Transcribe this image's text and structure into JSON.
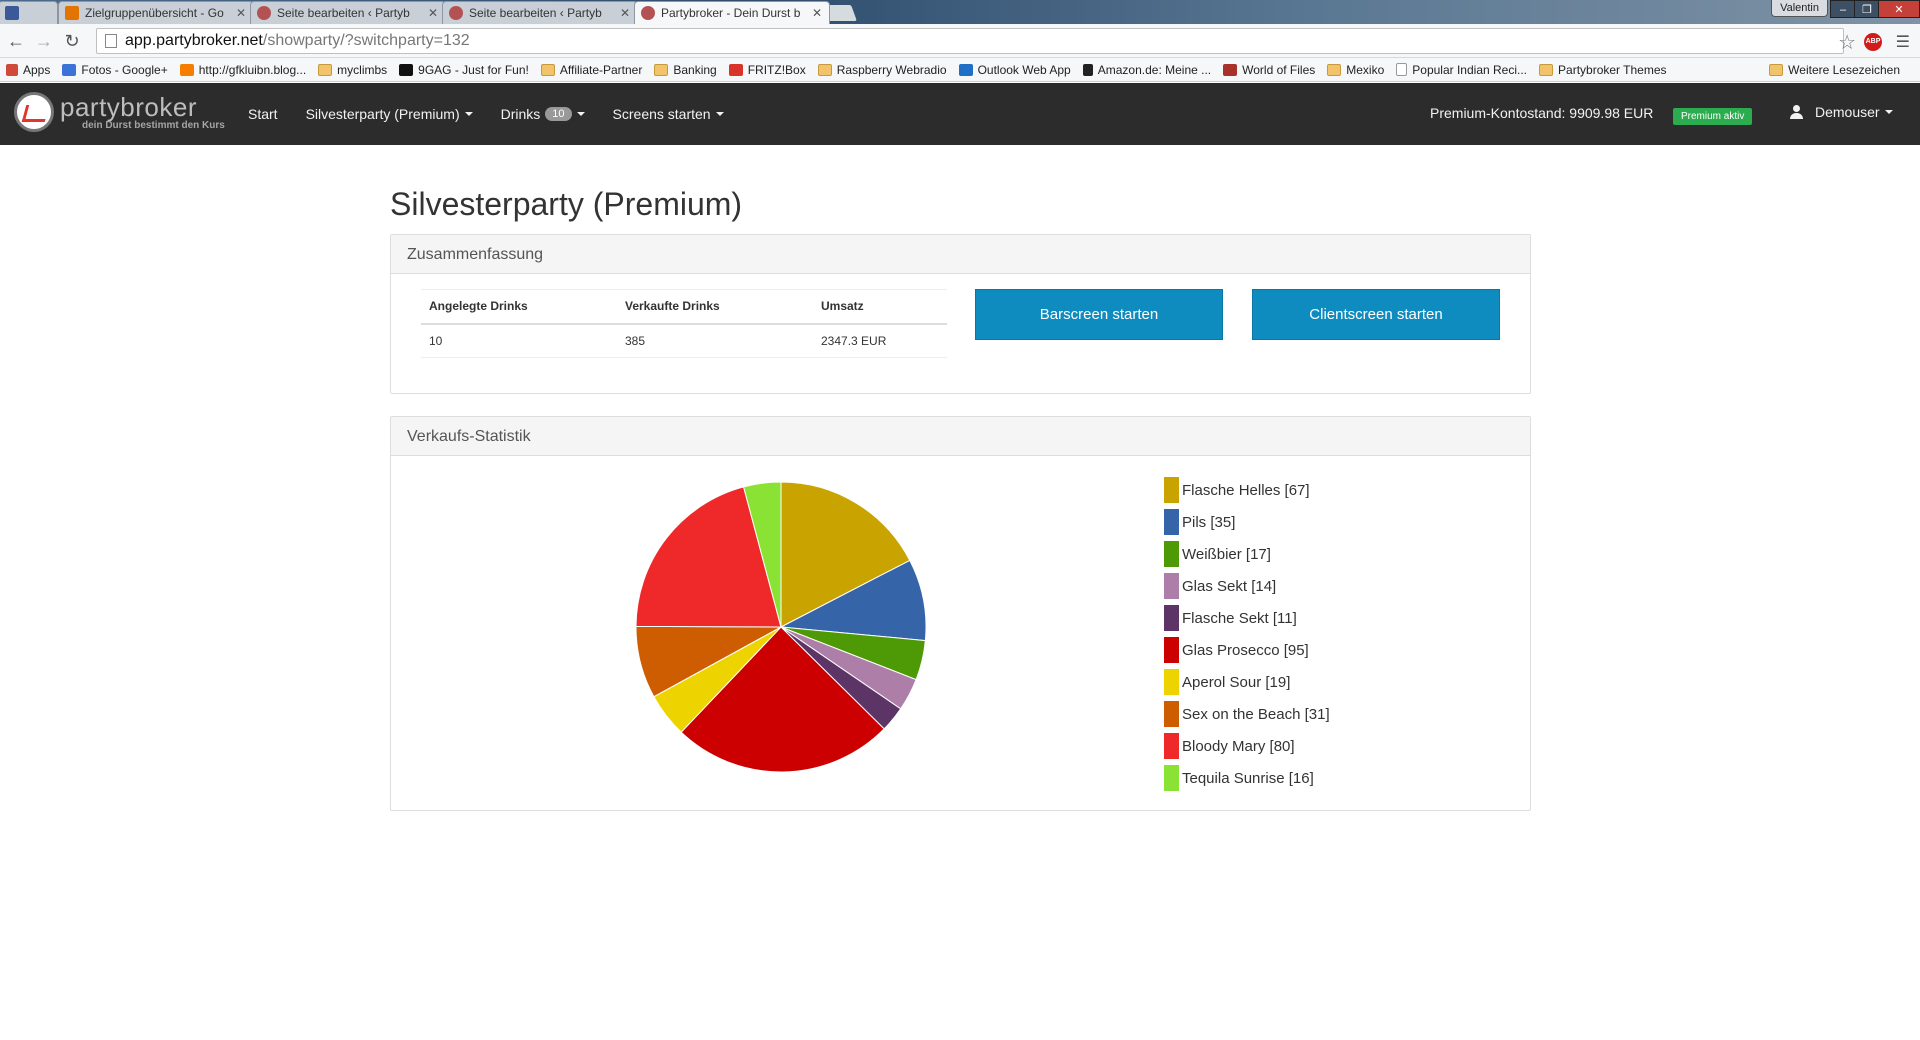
{
  "browser": {
    "tabs": [
      {
        "label": "Zielgruppenübersicht - Go",
        "favicon_color": "#e37400",
        "active": false
      },
      {
        "label": "Seite bearbeiten ‹ Partyb",
        "favicon_color": "#b35252",
        "active": false
      },
      {
        "label": "Seite bearbeiten ‹ Partyb",
        "favicon_color": "#b35252",
        "active": false
      },
      {
        "label": "Partybroker - Dein Durst b",
        "favicon_color": "#b35252",
        "active": true
      }
    ],
    "window_user": "Valentin",
    "url_host": "app.partybroker.net",
    "url_path": "/showparty/?switchparty=132",
    "abp_label": "ABP",
    "bookmarks": [
      {
        "label": "Apps",
        "icon": "apps-icon",
        "color": "#d04a3a"
      },
      {
        "label": "Fotos - Google+",
        "icon": "google-plus-icon",
        "color": "#3b73d6"
      },
      {
        "label": "http://gfkluibn.blog...",
        "icon": "blogger-icon",
        "color": "#f57d00"
      },
      {
        "label": "myclimbs",
        "icon": "folder-icon",
        "color": "#f1c36a"
      },
      {
        "label": "9GAG - Just for Fun!",
        "icon": "9gag-icon",
        "color": "#111111"
      },
      {
        "label": "Affiliate-Partner",
        "icon": "folder-icon",
        "color": "#f1c36a"
      },
      {
        "label": "Banking",
        "icon": "folder-icon",
        "color": "#f1c36a"
      },
      {
        "label": "FRITZ!Box",
        "icon": "fritzbox-icon",
        "color": "#d8342b"
      },
      {
        "label": "Raspberry Webradio",
        "icon": "folder-icon",
        "color": "#f1c36a"
      },
      {
        "label": "Outlook Web App",
        "icon": "outlook-icon",
        "color": "#1f6fc5"
      },
      {
        "label": "Amazon.de: Meine ...",
        "icon": "amazon-icon",
        "color": "#222222"
      },
      {
        "label": "World of Files",
        "icon": "world-of-files-icon",
        "color": "#a8322a"
      },
      {
        "label": "Mexiko",
        "icon": "folder-icon",
        "color": "#f1c36a"
      },
      {
        "label": "Popular Indian Reci...",
        "icon": "page-icon",
        "color": "#ffffff"
      },
      {
        "label": "Partybroker Themes",
        "icon": "folder-icon",
        "color": "#f1c36a"
      }
    ],
    "other_bookmarks": "Weitere Lesezeichen"
  },
  "navbar": {
    "logo_name": "partybroker",
    "logo_tagline": "dein Durst bestimmt den Kurs",
    "links": [
      {
        "label": "Start",
        "dropdown": false
      },
      {
        "label": "Silvesterparty (Premium)",
        "dropdown": true
      },
      {
        "label": "Drinks",
        "dropdown": true,
        "badge": "10"
      },
      {
        "label": "Screens starten",
        "dropdown": true
      }
    ],
    "balance": "Premium-Kontostand: 9909.98 EUR",
    "premium_label": "Premium aktiv",
    "user": "Demouser"
  },
  "page": {
    "title": "Silvesterparty (Premium)"
  },
  "summary": {
    "heading": "Zusammenfassung",
    "headers": [
      "Angelegte Drinks",
      "Verkaufte Drinks",
      "Umsatz"
    ],
    "values": [
      "10",
      "385",
      "2347.3 EUR"
    ],
    "barscreen_button": "Barscreen starten",
    "clientscreen_button": "Clientscreen starten"
  },
  "stats": {
    "heading": "Verkaufs-Statistik"
  },
  "chart_data": {
    "type": "pie",
    "title": "",
    "slices": [
      {
        "label": "Flasche Helles",
        "value": 67,
        "legend": "Flasche Helles [67]",
        "color": "#c9a400"
      },
      {
        "label": "Pils",
        "value": 35,
        "legend": "Pils [35]",
        "color": "#3565a8"
      },
      {
        "label": "Weißbier",
        "value": 17,
        "legend": "Weißbier [17]",
        "color": "#4e9a06"
      },
      {
        "label": "Glas Sekt",
        "value": 14,
        "legend": "Glas Sekt [14]",
        "color": "#ad7fa8"
      },
      {
        "label": "Flasche Sekt",
        "value": 11,
        "legend": "Flasche Sekt [11]",
        "color": "#5c3566"
      },
      {
        "label": "Glas Prosecco",
        "value": 95,
        "legend": "Glas Prosecco [95]",
        "color": "#cc0000"
      },
      {
        "label": "Aperol Sour",
        "value": 19,
        "legend": "Aperol Sour [19]",
        "color": "#edd400"
      },
      {
        "label": "Sex on the Beach",
        "value": 31,
        "legend": "Sex on the Beach [31]",
        "color": "#ce5c00"
      },
      {
        "label": "Bloody Mary",
        "value": 80,
        "legend": "Bloody Mary [80]",
        "color": "#ef2929"
      },
      {
        "label": "Tequila Sunrise",
        "value": 16,
        "legend": "Tequila Sunrise [16]",
        "color": "#8ae234"
      }
    ],
    "legend_position": "right"
  }
}
